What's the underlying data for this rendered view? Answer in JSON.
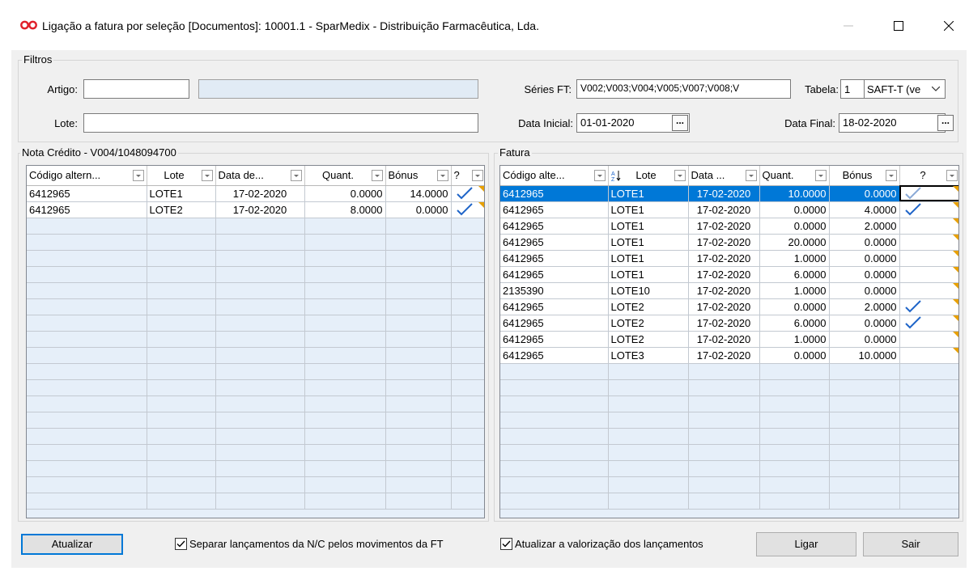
{
  "window": {
    "title": "Ligação a fatura por seleção [Documentos]: 10001.1 - SparMedix - Distribuição Farmacêutica, Lda."
  },
  "filtros": {
    "group_label": "Filtros",
    "artigo_label": "Artigo:",
    "artigo_value": "",
    "artigo_desc": "",
    "lote_label": "Lote:",
    "lote_value": "",
    "series_label": "Séries FT:",
    "series_value": "V002;V003;V004;V005;V007;V008;V",
    "tabela_label": "Tabela:",
    "tabela_value": "1",
    "tabela_combo": "SAFT-T (ve",
    "data_inicial_label": "Data Inicial:",
    "data_inicial_value": "01-01-2020",
    "data_final_label": "Data Final:",
    "data_final_value": "18-02-2020",
    "dots": "..."
  },
  "nota_credito": {
    "group_label": "Nota Crédito - V004/1048094700",
    "columns": [
      "Código altern...",
      "Lote",
      "Data de...",
      "Quant.",
      "Bónus",
      "?"
    ],
    "rows": [
      {
        "codigo": "6412965",
        "lote": "LOTE1",
        "data": "17-02-2020",
        "quant": "0.0000",
        "bonus": "14.0000",
        "checked": true
      },
      {
        "codigo": "6412965",
        "lote": "LOTE2",
        "data": "17-02-2020",
        "quant": "8.0000",
        "bonus": "0.0000",
        "checked": true
      }
    ]
  },
  "fatura": {
    "group_label": "Fatura",
    "columns": [
      "Código alte...",
      "Lote",
      "Data ...",
      "Quant.",
      "Bónus",
      "?"
    ],
    "rows": [
      {
        "codigo": "6412965",
        "lote": "LOTE1",
        "data": "17-02-2020",
        "quant": "10.0000",
        "bonus": "0.0000",
        "checked": true,
        "selected": true
      },
      {
        "codigo": "6412965",
        "lote": "LOTE1",
        "data": "17-02-2020",
        "quant": "0.0000",
        "bonus": "4.0000",
        "checked": true
      },
      {
        "codigo": "6412965",
        "lote": "LOTE1",
        "data": "17-02-2020",
        "quant": "0.0000",
        "bonus": "2.0000",
        "checked": false
      },
      {
        "codigo": "6412965",
        "lote": "LOTE1",
        "data": "17-02-2020",
        "quant": "20.0000",
        "bonus": "0.0000",
        "checked": false
      },
      {
        "codigo": "6412965",
        "lote": "LOTE1",
        "data": "17-02-2020",
        "quant": "1.0000",
        "bonus": "0.0000",
        "checked": false
      },
      {
        "codigo": "6412965",
        "lote": "LOTE1",
        "data": "17-02-2020",
        "quant": "6.0000",
        "bonus": "0.0000",
        "checked": false
      },
      {
        "codigo": "2135390",
        "lote": "LOTE10",
        "data": "17-02-2020",
        "quant": "1.0000",
        "bonus": "0.0000",
        "checked": false
      },
      {
        "codigo": "6412965",
        "lote": "LOTE2",
        "data": "17-02-2020",
        "quant": "0.0000",
        "bonus": "2.0000",
        "checked": true
      },
      {
        "codigo": "6412965",
        "lote": "LOTE2",
        "data": "17-02-2020",
        "quant": "6.0000",
        "bonus": "0.0000",
        "checked": true
      },
      {
        "codigo": "6412965",
        "lote": "LOTE2",
        "data": "17-02-2020",
        "quant": "1.0000",
        "bonus": "0.0000",
        "checked": false
      },
      {
        "codigo": "6412965",
        "lote": "LOTE3",
        "data": "17-02-2020",
        "quant": "0.0000",
        "bonus": "10.0000",
        "checked": false
      }
    ]
  },
  "footer": {
    "atualizar": "Atualizar",
    "chk_separar": "Separar lançamentos da N/C pelos movimentos da FT",
    "chk_atualizar_val": "Atualizar a valorização dos lançamentos",
    "ligar": "Ligar",
    "sair": "Sair"
  },
  "colors": {
    "selection": "#0078d7",
    "check": "#1e64c8",
    "corner_flag": "#e8a000",
    "grid_empty": "#e6eff9"
  }
}
